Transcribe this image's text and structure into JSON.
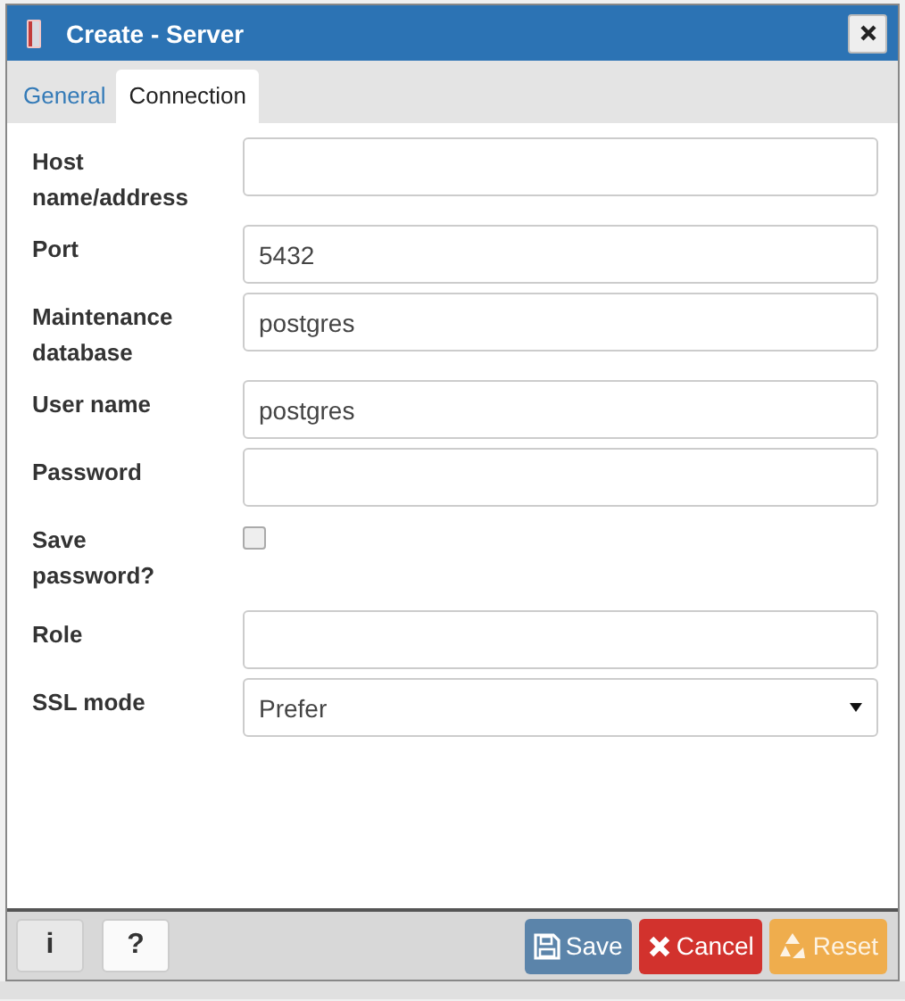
{
  "window": {
    "title": "Create - Server"
  },
  "tabs": [
    {
      "label": "General",
      "selected": false
    },
    {
      "label": "Connection",
      "selected": true
    }
  ],
  "fields": [
    {
      "kind": "text",
      "label": "Host name/address"
    },
    {
      "kind": "text",
      "label": "Port",
      "value": "5432"
    },
    {
      "kind": "text",
      "label": "Maintenance database",
      "value": "postgres"
    },
    {
      "kind": "text",
      "label": "User name",
      "value": "postgres"
    },
    {
      "kind": "text",
      "label": "Password"
    },
    {
      "kind": "checkbox",
      "label": "Save password?",
      "checked": false
    },
    {
      "kind": "text",
      "label": "Role"
    },
    {
      "kind": "select",
      "label": "SSL mode",
      "value": "Prefer"
    }
  ],
  "footer": {
    "info_button": "i",
    "help_button": "?",
    "buttons": [
      {
        "kind": "save",
        "label": "Save"
      },
      {
        "kind": "cancel",
        "label": "Cancel"
      },
      {
        "kind": "reset",
        "label": "Reset"
      }
    ]
  }
}
